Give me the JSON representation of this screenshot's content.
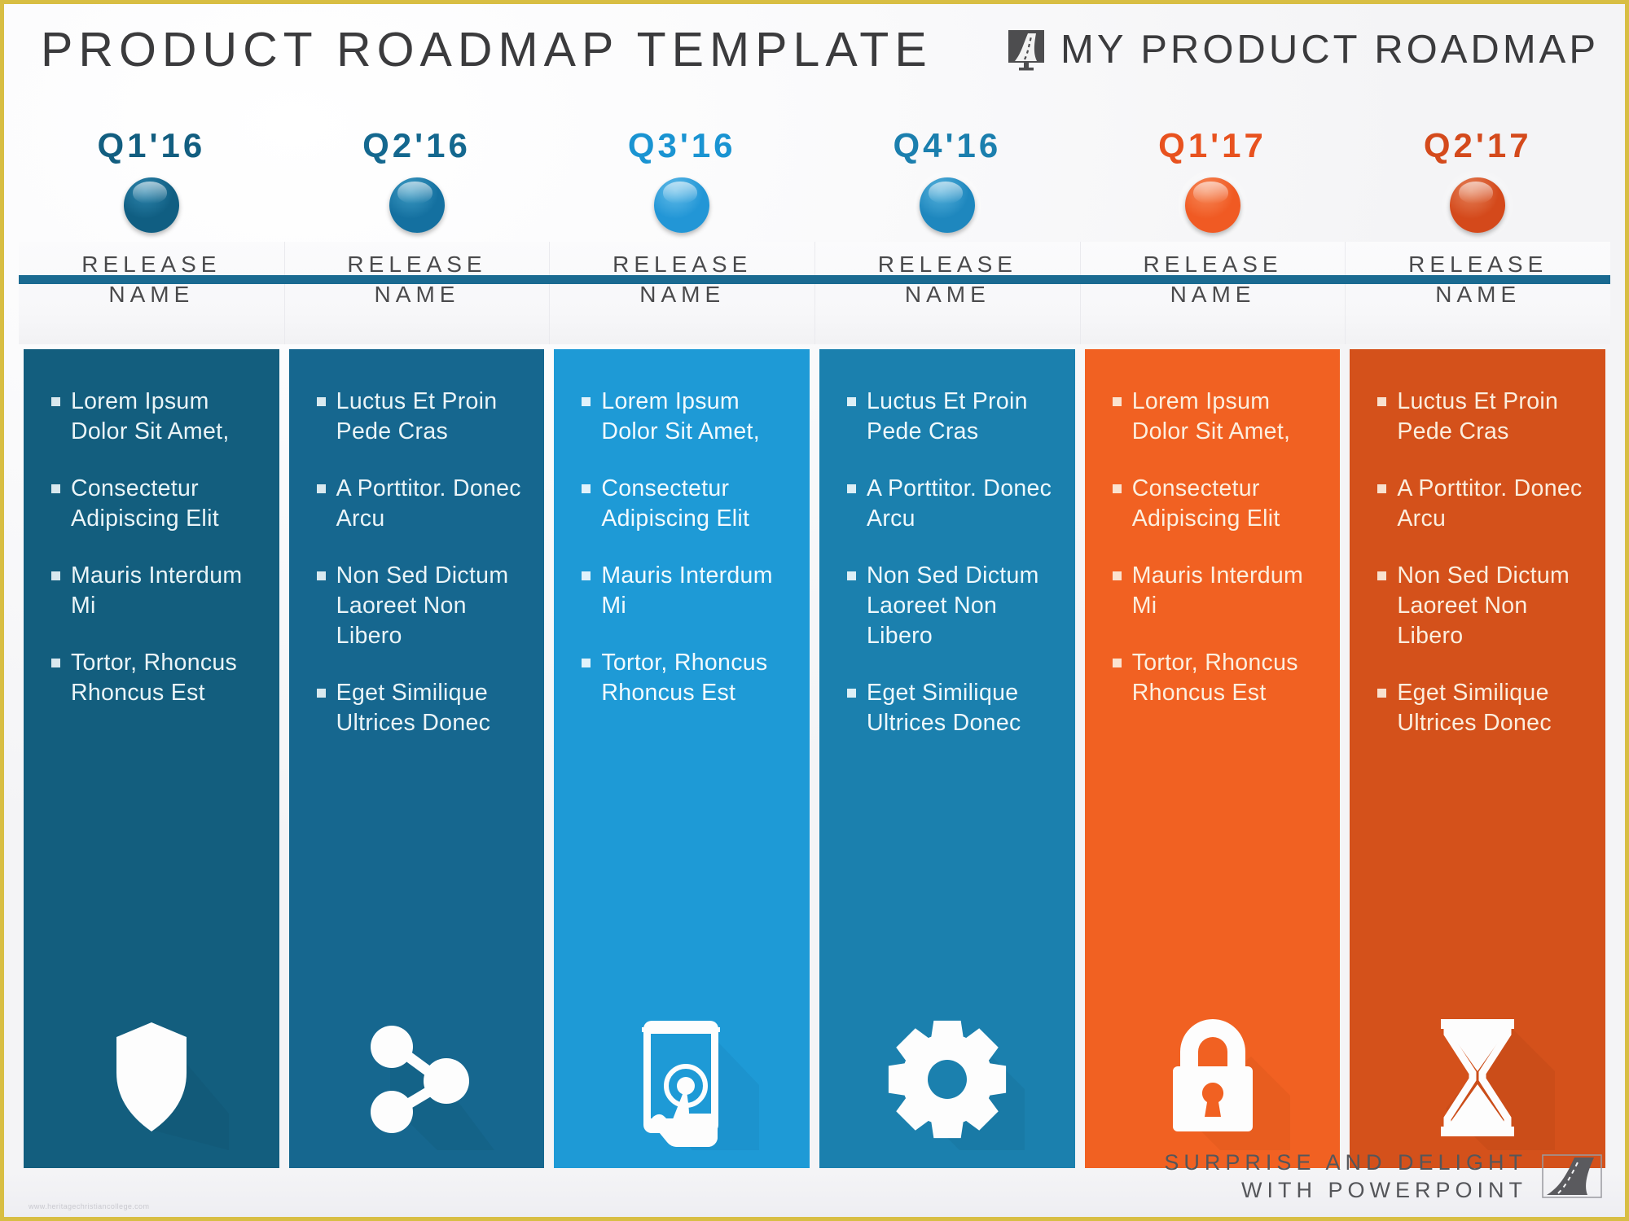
{
  "header": {
    "title": "PRODUCT ROADMAP TEMPLATE",
    "brand": "MY PRODUCT ROADMAP",
    "brand_icon": "road-logo-icon"
  },
  "theme": {
    "frame_border": "#D8BE43",
    "timeline_bar": "#1A6A91",
    "title_color": "#3b3b3d",
    "release_name_color": "#4a4a4c"
  },
  "columns": [
    {
      "quarter": "Q1'16",
      "quarter_color": "#125E80",
      "dot_color": "#105E82",
      "dot_top": "#2E86AE",
      "release_name": "RELEASE\nNAME",
      "release_name_l1": "RELEASE",
      "release_name_l2": "NAME",
      "card_color": "#135E7E",
      "card_shadow": "#0F4F6B",
      "text_color": "#EAF4F7",
      "icon": "shield-icon",
      "bullets": [
        "Lorem Ipsum Dolor Sit Amet,",
        "Consectetur Adipiscing Elit",
        "Mauris Interdum Mi",
        "Tortor, Rhoncus Rhoncus Est"
      ]
    },
    {
      "quarter": "Q2'16",
      "quarter_color": "#14688F",
      "dot_color": "#1470A0",
      "dot_top": "#3F9CC4",
      "release_name_l1": "RELEASE",
      "release_name_l2": "NAME",
      "card_color": "#16678F",
      "card_shadow": "#115777",
      "text_color": "#EAF4F7",
      "icon": "share-icon",
      "bullets": [
        "Luctus Et Proin Pede Cras",
        "A Porttitor. Donec Arcu",
        "Non Sed Dictum Laoreet Non Libero",
        "Eget Similique Ultrices Donec"
      ]
    },
    {
      "quarter": "Q3'16",
      "quarter_color": "#1A94D2",
      "dot_color": "#2296D6",
      "dot_top": "#63BCE8",
      "release_name_l1": "RELEASE",
      "release_name_l2": "NAME",
      "card_color": "#1E9AD6",
      "card_shadow": "#1782B7",
      "text_color": "#F2FAFE",
      "icon": "mobile-touch-icon",
      "bullets": [
        "Lorem Ipsum Dolor Sit Amet,",
        "Consectetur Adipiscing Elit",
        "Mauris Interdum Mi",
        "Tortor, Rhoncus Rhoncus Est"
      ]
    },
    {
      "quarter": "Q4'16",
      "quarter_color": "#1B7FAE",
      "dot_color": "#1E87BE",
      "dot_top": "#57B2DC",
      "release_name_l1": "RELEASE",
      "release_name_l2": "NAME",
      "card_color": "#1B80AE",
      "card_shadow": "#166B92",
      "text_color": "#EEF8FC",
      "icon": "gear-icon",
      "bullets": [
        "Luctus Et Proin Pede Cras",
        "A Porttitor. Donec Arcu",
        "Non Sed Dictum Laoreet Non Libero",
        "Eget Similique Ultrices Donec"
      ]
    },
    {
      "quarter": "Q1'17",
      "quarter_color": "#E8521F",
      "dot_color": "#F05A23",
      "dot_top": "#F68A5A",
      "release_name_l1": "RELEASE",
      "release_name_l2": "NAME",
      "card_color": "#F16122",
      "card_shadow": "#D2511A",
      "text_color": "#FCEFDF",
      "icon": "lock-icon",
      "bullets": [
        "Lorem Ipsum Dolor Sit Amet,",
        "Consectetur Adipiscing Elit",
        "Mauris Interdum Mi",
        "Tortor, Rhoncus Rhoncus Est"
      ]
    },
    {
      "quarter": "Q2'17",
      "quarter_color": "#D44A1C",
      "dot_color": "#D4491B",
      "dot_top": "#E4825A",
      "release_name_l1": "RELEASE",
      "release_name_l2": "NAME",
      "card_color": "#D4511B",
      "card_shadow": "#B44315",
      "text_color": "#FBEEDE",
      "icon": "hourglass-icon",
      "bullets": [
        "Luctus Et Proin Pede Cras",
        "A Porttitor. Donec Arcu",
        "Non Sed Dictum Laoreet Non Libero",
        "Eget Similique Ultrices Donec"
      ]
    }
  ],
  "footer": {
    "line1": "SURPRISE AND DELIGHT",
    "line2": "WITH POWERPOINT",
    "mark_icon": "road-logo-icon",
    "watermark": "www.heritagechristiancollege.com"
  }
}
